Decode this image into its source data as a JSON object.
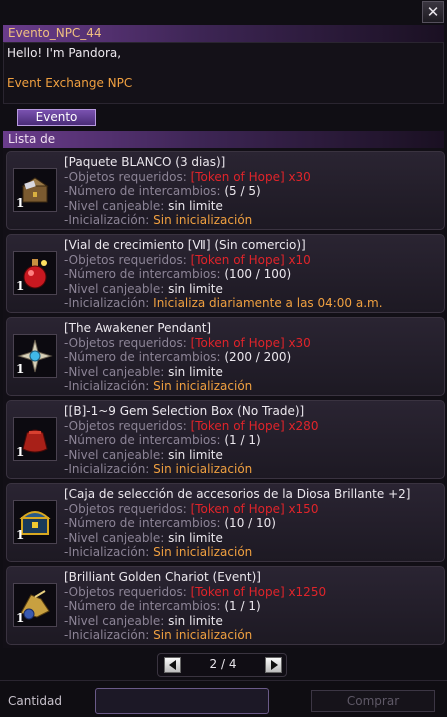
{
  "window": {
    "close_glyph": "✕"
  },
  "npc": {
    "name": "Evento_NPC_44",
    "greeting": "Hello! I'm Pandora,",
    "role": "Event Exchange NPC"
  },
  "tabs": {
    "active": "Evento"
  },
  "list": {
    "header": "Lista de",
    "items": [
      {
        "title": "[Paquete BLANCO (3 dias)]",
        "req_label": "-Objetos requeridos: ",
        "req_value": "[Token of Hope] x30",
        "exch_label": "-Número de intercambios: ",
        "exch_value": "(5 / 5)",
        "level_label": "-Nivel canjeable: ",
        "level_value": "sin limite",
        "init_label": "-Inicialización: ",
        "init_value": "Sin inicialización",
        "qty": "1",
        "icon": "chest-icon"
      },
      {
        "title": "[Vial de crecimiento [Ⅶ] (Sin comercio)]",
        "req_label": "-Objetos requeridos: ",
        "req_value": "[Token of Hope] x10",
        "exch_label": "-Número de intercambios: ",
        "exch_value": "(100 / 100)",
        "level_label": "-Nivel canjeable: ",
        "level_value": "sin limite",
        "init_label": "-Inicialización: ",
        "init_value": "Inicializa diariamente a las 04:00 a.m.",
        "qty": "1",
        "icon": "potion-vial-icon"
      },
      {
        "title": "[The Awakener Pendant]",
        "req_label": "-Objetos requeridos: ",
        "req_value": "[Token of Hope] x30",
        "exch_label": "-Número de intercambios: ",
        "exch_value": "(200 / 200)",
        "level_label": "-Nivel canjeable: ",
        "level_value": "sin limite",
        "init_label": "-Inicialización: ",
        "init_value": "Sin inicialización",
        "qty": "1",
        "icon": "pendant-icon"
      },
      {
        "title": "[[B]-1~9 Gem Selection Box (No Trade)]",
        "req_label": "-Objetos requeridos: ",
        "req_value": "[Token of Hope] x280",
        "exch_label": "-Número de intercambios: ",
        "exch_value": "(1 / 1)",
        "level_label": "-Nivel canjeable: ",
        "level_value": "sin limite",
        "init_label": "-Inicialización: ",
        "init_value": "Sin inicialización",
        "qty": "1",
        "icon": "gem-pouch-icon"
      },
      {
        "title": "[Caja de selección de accesorios de la Diosa Brillante +2]",
        "req_label": "-Objetos requeridos: ",
        "req_value": "[Token of Hope] x150",
        "exch_label": "-Número de intercambios: ",
        "exch_value": "(10 / 10)",
        "level_label": "-Nivel canjeable: ",
        "level_value": "sin limite",
        "init_label": "-Inicialización: ",
        "init_value": "Sin inicialización",
        "qty": "1",
        "icon": "treasure-chest-icon"
      },
      {
        "title": "[Brilliant Golden Chariot (Event)]",
        "req_label": "-Objetos requeridos: ",
        "req_value": "[Token of Hope] x1250",
        "exch_label": "-Número de intercambios: ",
        "exch_value": "(1 / 1)",
        "level_label": "-Nivel canjeable: ",
        "level_value": "sin limite",
        "init_label": "-Inicialización: ",
        "init_value": "Sin inicialización",
        "qty": "1",
        "icon": "chariot-icon"
      }
    ]
  },
  "pager": {
    "label": "2 / 4",
    "current": 2,
    "total": 4
  },
  "footer": {
    "quantity_label": "Cantidad",
    "quantity_value": "",
    "buy_label": "Comprar"
  }
}
